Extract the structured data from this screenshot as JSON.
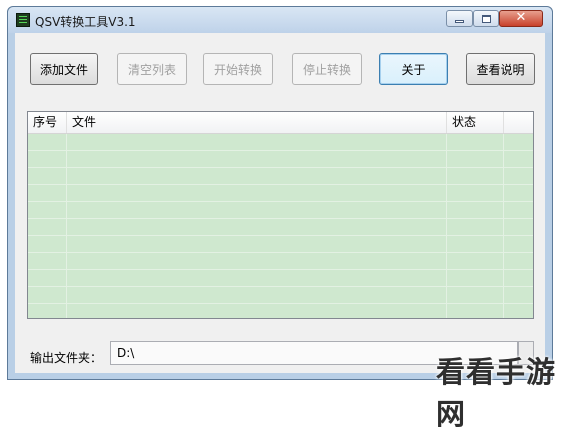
{
  "window": {
    "title": "QSV转换工具V3.1",
    "close_glyph": "✕"
  },
  "toolbar": {
    "add_files": "添加文件",
    "clear_list": "清空列表",
    "start_convert": "开始转换",
    "stop_convert": "停止转换",
    "about": "关于",
    "view_help": "查看说明"
  },
  "file_list": {
    "columns": [
      "序号",
      "文件",
      "状态",
      ""
    ],
    "rows": []
  },
  "output": {
    "label": "输出文件夹：",
    "value": "D:\\"
  },
  "watermark": "看看手游网",
  "colors": {
    "list_background": "#cfe8cf",
    "window_frame": "#b9cfe6",
    "close_button": "#c8412b"
  }
}
